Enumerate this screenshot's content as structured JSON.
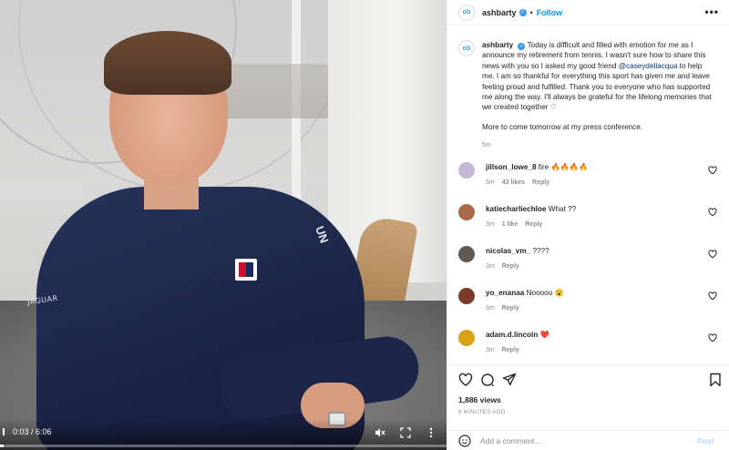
{
  "video": {
    "time_display": "0:03 / 6:06",
    "progress_fraction": 0.008,
    "sleeve_text": "JAGUAR",
    "shoulder_text": "UN"
  },
  "header": {
    "avatar_text": "ob",
    "username": "ashbarty",
    "separator": "•",
    "follow_label": "Follow",
    "more_label": "•••"
  },
  "caption": {
    "avatar_text": "ob",
    "username": "ashbarty",
    "text_before_mention": "Today is difficult and filled with emotion for me as I announce my retirement from tennis. I wasn't sure how to share this news with you so I asked my good friend ",
    "mention": "@caseydellacqua",
    "text_after_mention": " to help me. I am so thankful for everything this sport has given me and leave feeling proud and fulfilled. Thank you to everyone who has supported me along the way. I'll always be grateful for the lifelong memories that we created together ",
    "heart": "♡",
    "more_text": "More to come tomorrow at my press conference.",
    "time": "5m"
  },
  "comments": [
    {
      "user": "jillson_lowe_8",
      "text": "fire 🔥🔥🔥🔥",
      "time": "5m",
      "likes": "43 likes",
      "reply": "Reply",
      "avatar_color": "#c7b7d6"
    },
    {
      "user": "katiecharliechloe",
      "text": "What ??",
      "time": "3m",
      "likes": "1 like",
      "reply": "Reply",
      "avatar_color": "#a86b4a"
    },
    {
      "user": "nicolas_vm_",
      "text": "????",
      "time": "3m",
      "likes": "",
      "reply": "Reply",
      "avatar_color": "#5f5a54"
    },
    {
      "user": "yo_enanaa",
      "text": "Nooooo 😮",
      "time": "3m",
      "likes": "",
      "reply": "Reply",
      "avatar_color": "#7a3b2b"
    },
    {
      "user": "adam.d.lincoln",
      "text": "❤️",
      "time": "3m",
      "likes": "",
      "reply": "Reply",
      "avatar_color": "#d9a21b"
    }
  ],
  "stats": {
    "views": "1,886 views",
    "posted": "6 MINUTES AGO"
  },
  "comment_box": {
    "placeholder": "Add a comment…",
    "post_label": "Post"
  },
  "colors": {
    "link_blue": "#0095f6",
    "verified_blue": "#3897f0",
    "mention_blue": "#00376b",
    "muted": "#8e8e8e"
  }
}
